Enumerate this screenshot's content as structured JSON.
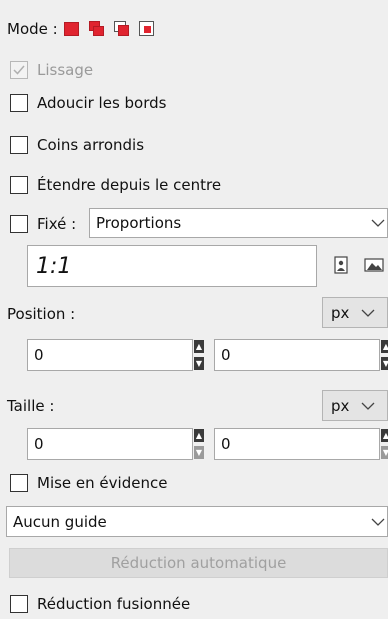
{
  "mode": {
    "label": "Mode :",
    "buttons": [
      {
        "name": "replace-mode",
        "color": "#e0242f"
      },
      {
        "name": "add-mode",
        "color": "#e0242f"
      },
      {
        "name": "subtract-mode",
        "color": "#e0242f"
      },
      {
        "name": "intersect-mode",
        "color": "#e0242f"
      }
    ]
  },
  "options": {
    "smooth": "Lissage",
    "antialias": "Adoucir les bords",
    "rounded": "Coins arrondis",
    "expand_center": "Étendre depuis le centre",
    "fixed": "Fixé :",
    "fixed_select": "Proportions",
    "ratio_value": "1:1"
  },
  "position": {
    "label": "Position :",
    "unit": "px",
    "x": "0",
    "y": "0"
  },
  "size": {
    "label": "Taille :",
    "unit": "px",
    "w": "0",
    "h": "0"
  },
  "highlight": "Mise en évidence",
  "guides": "Aucun guide",
  "auto_shrink": "Réduction automatique",
  "shrink_merged": "Réduction fusionnée",
  "icons": {
    "portrait": "portrait-icon",
    "landscape": "landscape-icon"
  }
}
